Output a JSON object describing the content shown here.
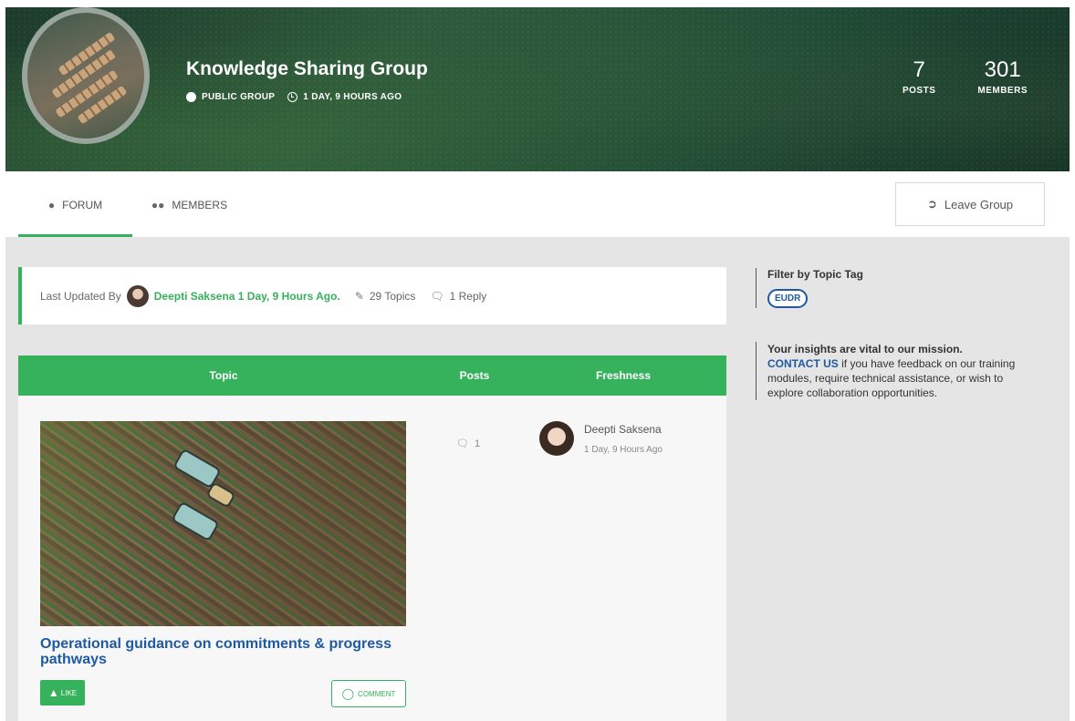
{
  "header": {
    "group_title": "Knowledge Sharing Group",
    "visibility": "PUBLIC GROUP",
    "last_active": "1 DAY, 9 HOURS AGO",
    "stats": [
      {
        "value": "7",
        "label": "POSTS"
      },
      {
        "value": "301",
        "label": "MEMBERS"
      }
    ]
  },
  "tabs": [
    {
      "label": "FORUM",
      "icon": "chat-bubble-icon",
      "active": true
    },
    {
      "label": "MEMBERS",
      "icon": "users-icon",
      "active": false
    }
  ],
  "actions": {
    "leave_label": "Leave Group"
  },
  "info_bar": {
    "prefix": "Last Updated By",
    "author_time": "Deepti Saksena 1 Day, 9 Hours Ago.",
    "topics": "29 Topics",
    "replies": "1 Reply"
  },
  "table": {
    "headers": {
      "topic": "Topic",
      "posts": "Posts",
      "freshness": "Freshness"
    },
    "rows": [
      {
        "title": "Operational guidance on commitments & progress pathways",
        "posts": "1",
        "fresh_name": "Deepti Saksena",
        "fresh_time": "1 Day, 9 Hours Ago",
        "like_label": "LIKE",
        "comment_label": "COMMENT"
      }
    ]
  },
  "sidebar": {
    "filter_title": "Filter by Topic Tag",
    "tags": [
      "EUDR"
    ],
    "insight_title": "Your insights are vital to our mission.",
    "contact_label": "CONTACT US",
    "contact_text": " if you have feedback on our training modules, require technical assistance, or wish to explore collaboration opportunities."
  },
  "colors": {
    "accent": "#36b15c",
    "link": "#1e5aa3",
    "background": "#e5e5e5"
  }
}
